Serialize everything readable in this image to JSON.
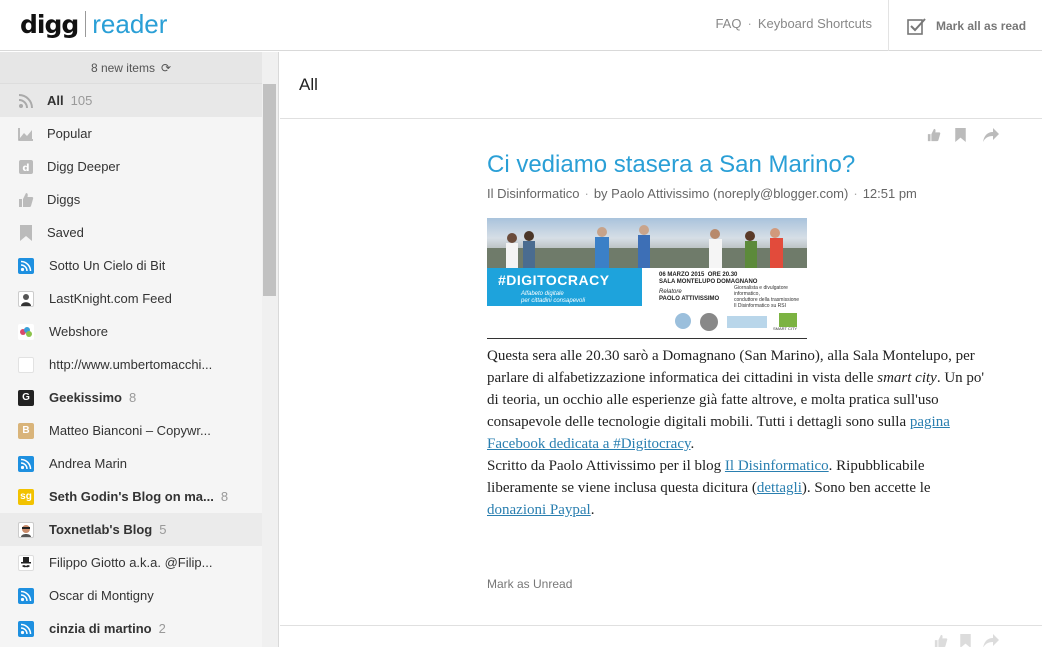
{
  "header": {
    "logo_digg": "digg",
    "logo_reader": "reader",
    "faq": "FAQ",
    "separator": "·",
    "shortcuts": "Keyboard Shortcuts",
    "mark_all": "Mark all as read"
  },
  "sidebar": {
    "new_items": "8 new items",
    "refresh_glyph": "⟳",
    "nav": [
      {
        "label": "All",
        "count": "105",
        "icon": "rss-icon"
      },
      {
        "label": "Popular",
        "icon": "chart-icon"
      },
      {
        "label": "Digg Deeper",
        "icon": "digg-icon"
      },
      {
        "label": "Diggs",
        "icon": "thumbs-up-icon"
      },
      {
        "label": "Saved",
        "icon": "bookmark-icon"
      }
    ],
    "feeds": [
      {
        "label": "Sotto Un Cielo di Bit",
        "count": ""
      },
      {
        "label": "LastKnight.com Feed",
        "count": ""
      },
      {
        "label": "Webshore",
        "count": ""
      },
      {
        "label": "http://www.umbertomacchi...",
        "count": ""
      },
      {
        "label": "Geekissimo",
        "count": "8"
      },
      {
        "label": "Matteo Bianconi – Copywr...",
        "count": ""
      },
      {
        "label": "Andrea Marin",
        "count": ""
      },
      {
        "label": "Seth Godin's Blog on ma...",
        "count": "8"
      },
      {
        "label": "Toxnetlab's Blog",
        "count": "5"
      },
      {
        "label": "Filippo Giotto a.k.a. @Filip...",
        "count": ""
      },
      {
        "label": "Oscar di Montigny",
        "count": ""
      },
      {
        "label": "cinzia di martino",
        "count": "2"
      }
    ]
  },
  "main": {
    "heading": "All",
    "article": {
      "title": "Ci vediamo stasera a San Marino?",
      "source": "Il Disinformatico",
      "author": "by Paolo Attivissimo (noreply@blogger.com)",
      "time": "12:51 pm",
      "meta_sep": "·",
      "banner": {
        "hashtag": "#DIGITOCRACY",
        "subtitle1": "Alfabeto digitale",
        "subtitle2": "per cittadini consapevoli",
        "date": "06 MARZO 2015",
        "hour": "ORE 20.30",
        "venue": "SALA MONTELUPO",
        "place": "DOMAGNANO",
        "speaker_label": "Relatore",
        "speaker": "PAOLO ATTIVISSIMO",
        "desc1": "Giornalista e divulgatore informatico,",
        "desc2": "conduttore della trasmissione",
        "desc3": "Il Disinformatico su RSI",
        "logo_text": "SMART CITY"
      },
      "p1_a": "Questa sera alle 20.30 sarò a Domagnano (San Marino), alla Sala Montelupo, per parlare di alfabetizzazione informatica dei cittadini in vista delle ",
      "p1_em": "smart city",
      "p1_b": ". Un po' di teoria, un occhio alle esperienze già fatte altrove, e molta pratica sull'uso consapevole delle tecnologie digitali mobili. Tutti i dettagli sono sulla ",
      "p1_link": "pagina Facebook dedicata a #Digitocracy",
      "p1_end": ".",
      "p2_a": "Scritto da Paolo Attivissimo per il blog ",
      "p2_link1": "Il Disinformatico",
      "p2_b": ". Ripubblicabile liberamente se viene inclusa questa dicitura (",
      "p2_link2": "dettagli",
      "p2_c": "). Sono ben accette le ",
      "p2_link3": "donazioni Paypal",
      "p2_end": ".",
      "mark_unread": "Mark as Unread"
    }
  },
  "colors": {
    "accent": "#2a9fd6",
    "rss": "#1e90e0",
    "banner_blue": "#1ea3dc"
  }
}
